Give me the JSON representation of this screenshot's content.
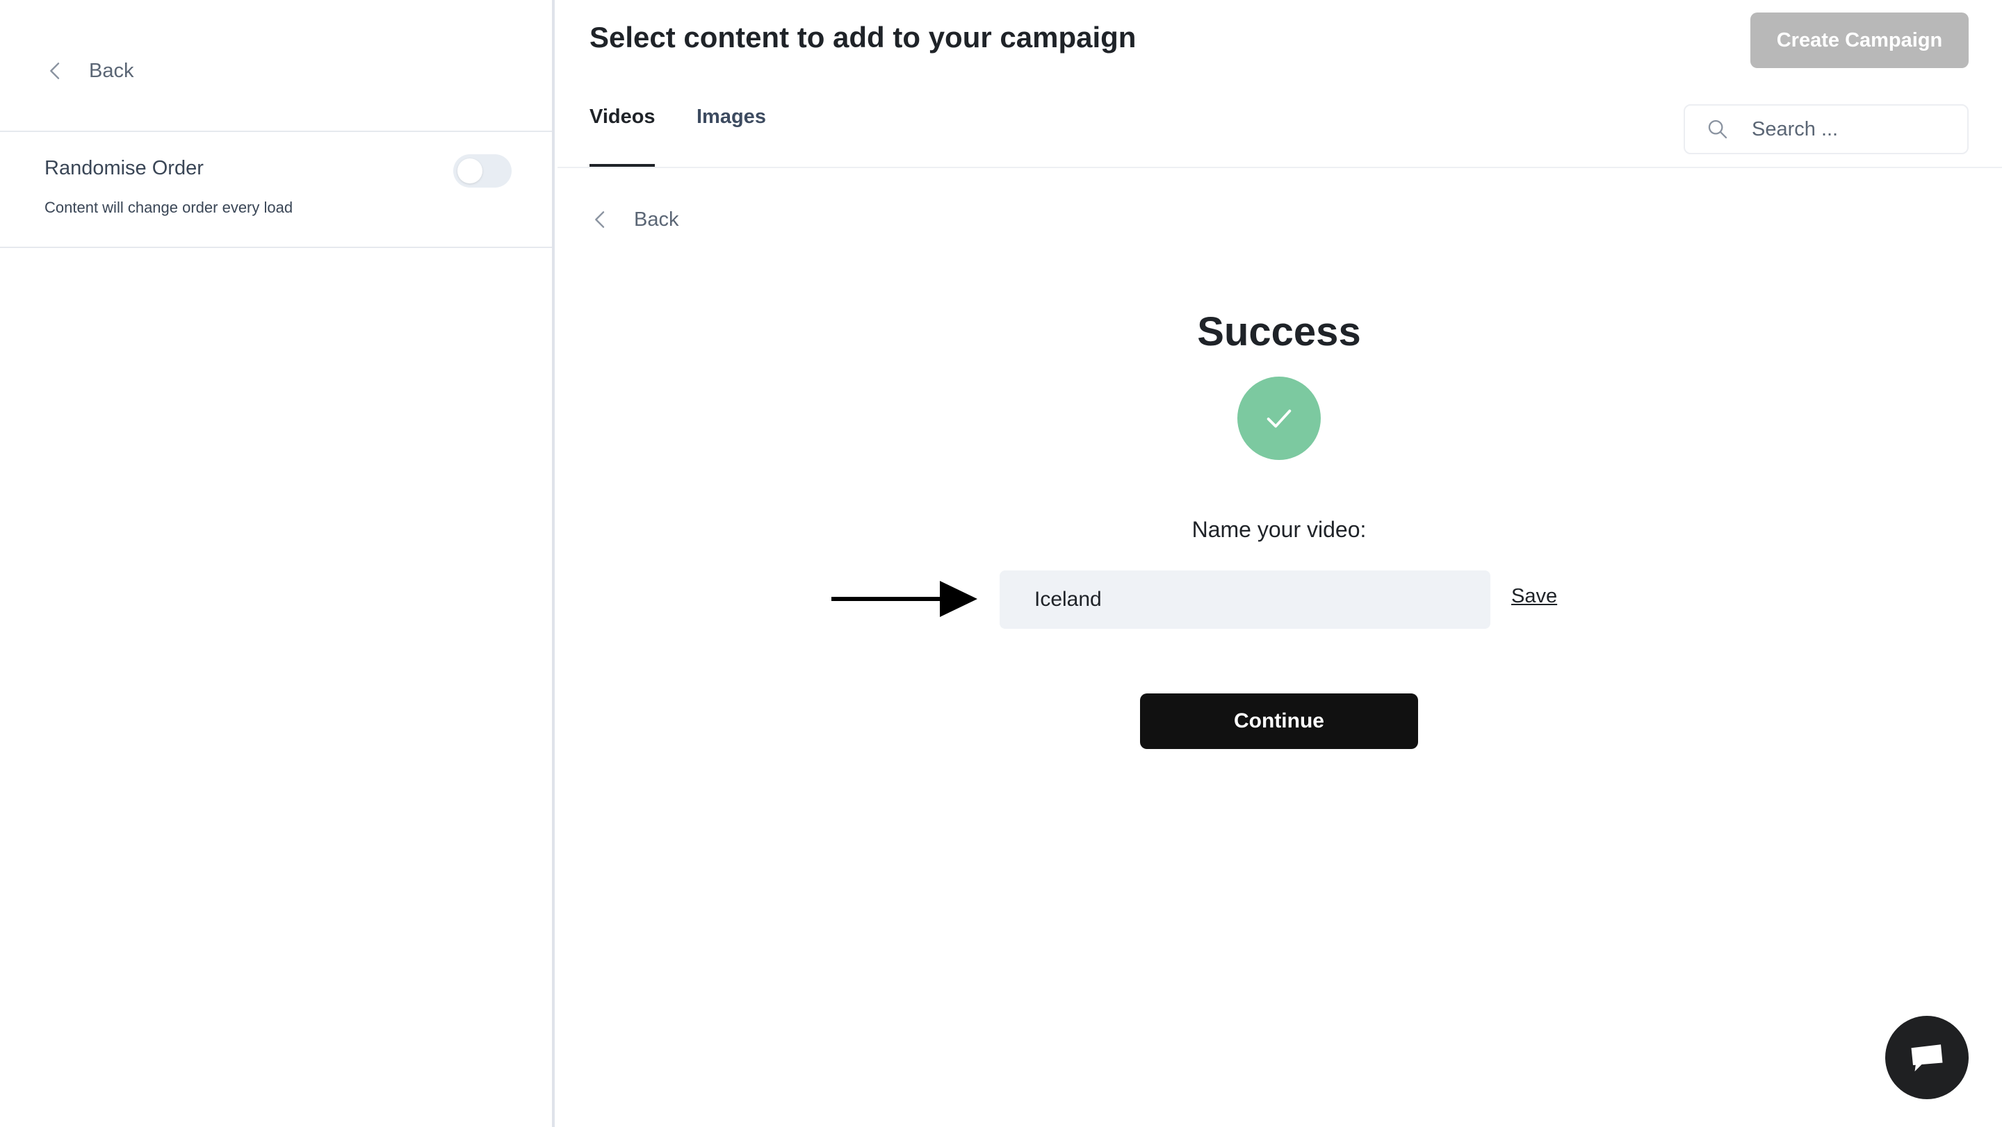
{
  "sidebar": {
    "back_label": "Back",
    "randomise": {
      "title": "Randomise Order",
      "description": "Content will change order every load",
      "enabled": false
    }
  },
  "header": {
    "title": "Select content to add to your campaign",
    "create_button": "Create Campaign",
    "tabs": [
      {
        "label": "Videos",
        "active": true
      },
      {
        "label": "Images",
        "active": false
      }
    ],
    "search": {
      "placeholder": "Search ..."
    }
  },
  "content": {
    "back_label": "Back",
    "success_title": "Success",
    "name_label": "Name your video:",
    "name_value": "Iceland",
    "save_label": "Save",
    "continue_label": "Continue"
  },
  "colors": {
    "success_green": "#7cc9a0",
    "disabled_button": "#b8b8b8",
    "primary_button": "#111111",
    "input_background": "#eff2f6"
  },
  "icons": {
    "back": "chevron-left-icon",
    "search": "search-icon",
    "success": "check-icon",
    "annotation": "arrow-right-icon",
    "chat": "chat-bubble-icon"
  }
}
